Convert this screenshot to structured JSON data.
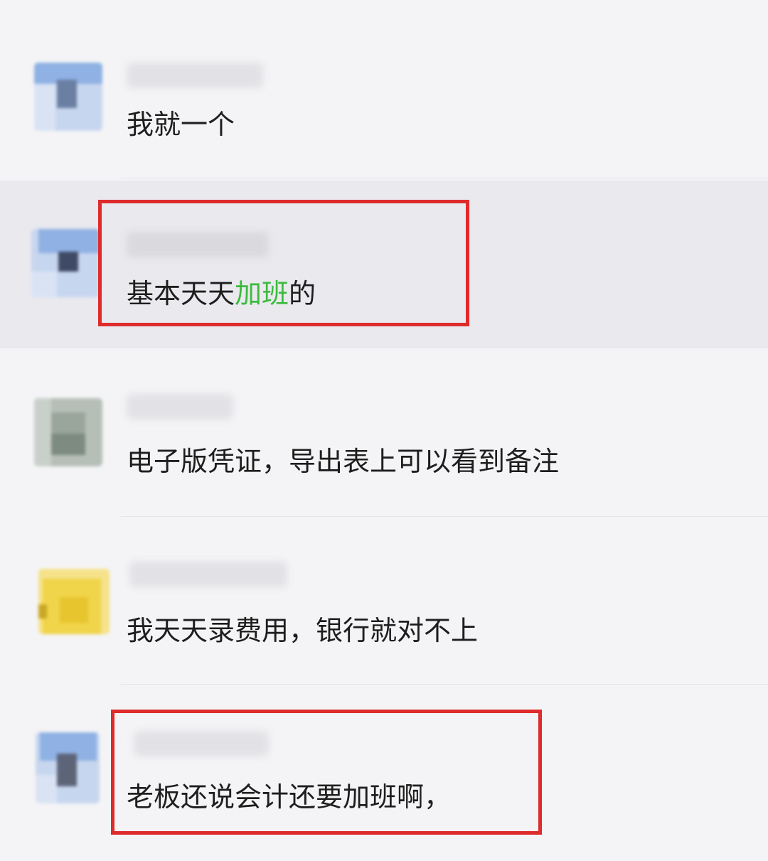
{
  "chat": {
    "messages": [
      {
        "text": "我就一个",
        "avatar_colors": [
          "#8fb1e3",
          "#6b7fa3",
          "#c7d6ef",
          "#d9e3f4"
        ]
      },
      {
        "text_before": "基本天天",
        "text_highlight": "加班",
        "text_after": "的",
        "highlight_color": "#3dba3d",
        "annotated": true,
        "row_selected": true,
        "avatar_colors": [
          "#8fb1e3",
          "#3f4a66",
          "#c7d6ef",
          "#d9e3f4"
        ]
      },
      {
        "text": "电子版凭证，导出表上可以看到备注",
        "avatar_colors": [
          "#9aa59c",
          "#7d8b80",
          "#b6bfb7",
          "#c9d0ca"
        ]
      },
      {
        "text": "我天天录费用，银行就对不上",
        "avatar_colors": [
          "#f0d44a",
          "#e7c52e",
          "#f5e28a",
          "#c9a722"
        ]
      },
      {
        "text": "老板还说会计还要加班啊，",
        "annotated": true,
        "avatar_colors": [
          "#8fb1e3",
          "#5d6478",
          "#c7d6ef",
          "#d9e3f4"
        ]
      }
    ],
    "annotation_color": "#de2b2b"
  }
}
